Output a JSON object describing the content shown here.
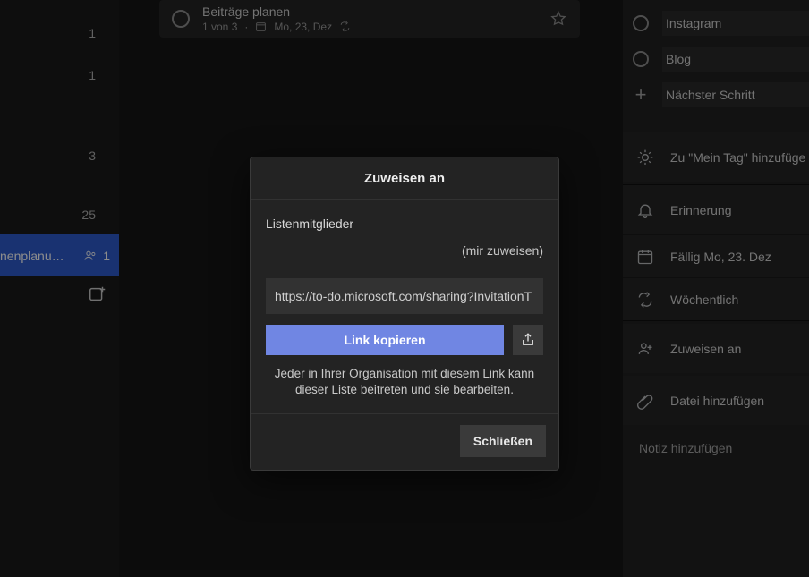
{
  "sidebar": {
    "counts": [
      "1",
      "1",
      "",
      "3",
      "",
      "25"
    ],
    "active": {
      "label": "nenplanu…",
      "count": "1"
    }
  },
  "task": {
    "title": "Beiträge planen",
    "progress": "1 von 3",
    "due": "Mo, 23, Dez"
  },
  "detail": {
    "steps": [
      "Instagram",
      "Blog"
    ],
    "add_step": "Nächster Schritt",
    "my_day": "Zu \"Mein Tag\" hinzufüge",
    "reminder": "Erinnerung",
    "due": "Fällig Mo, 23. Dez",
    "repeat": "Wöchentlich",
    "assign": "Zuweisen an",
    "attach": "Datei hinzufügen",
    "note": "Notiz hinzufügen"
  },
  "dialog": {
    "title": "Zuweisen an",
    "members_label": "Listenmitglieder",
    "self_assign": "(mir zuweisen)",
    "url": "https://to-do.microsoft.com/sharing?InvitationT",
    "copy_label": "Link kopieren",
    "disclaimer": "Jeder in Ihrer Organisation mit diesem Link kann dieser Liste beitreten und sie bearbeiten.",
    "close": "Schließen"
  }
}
